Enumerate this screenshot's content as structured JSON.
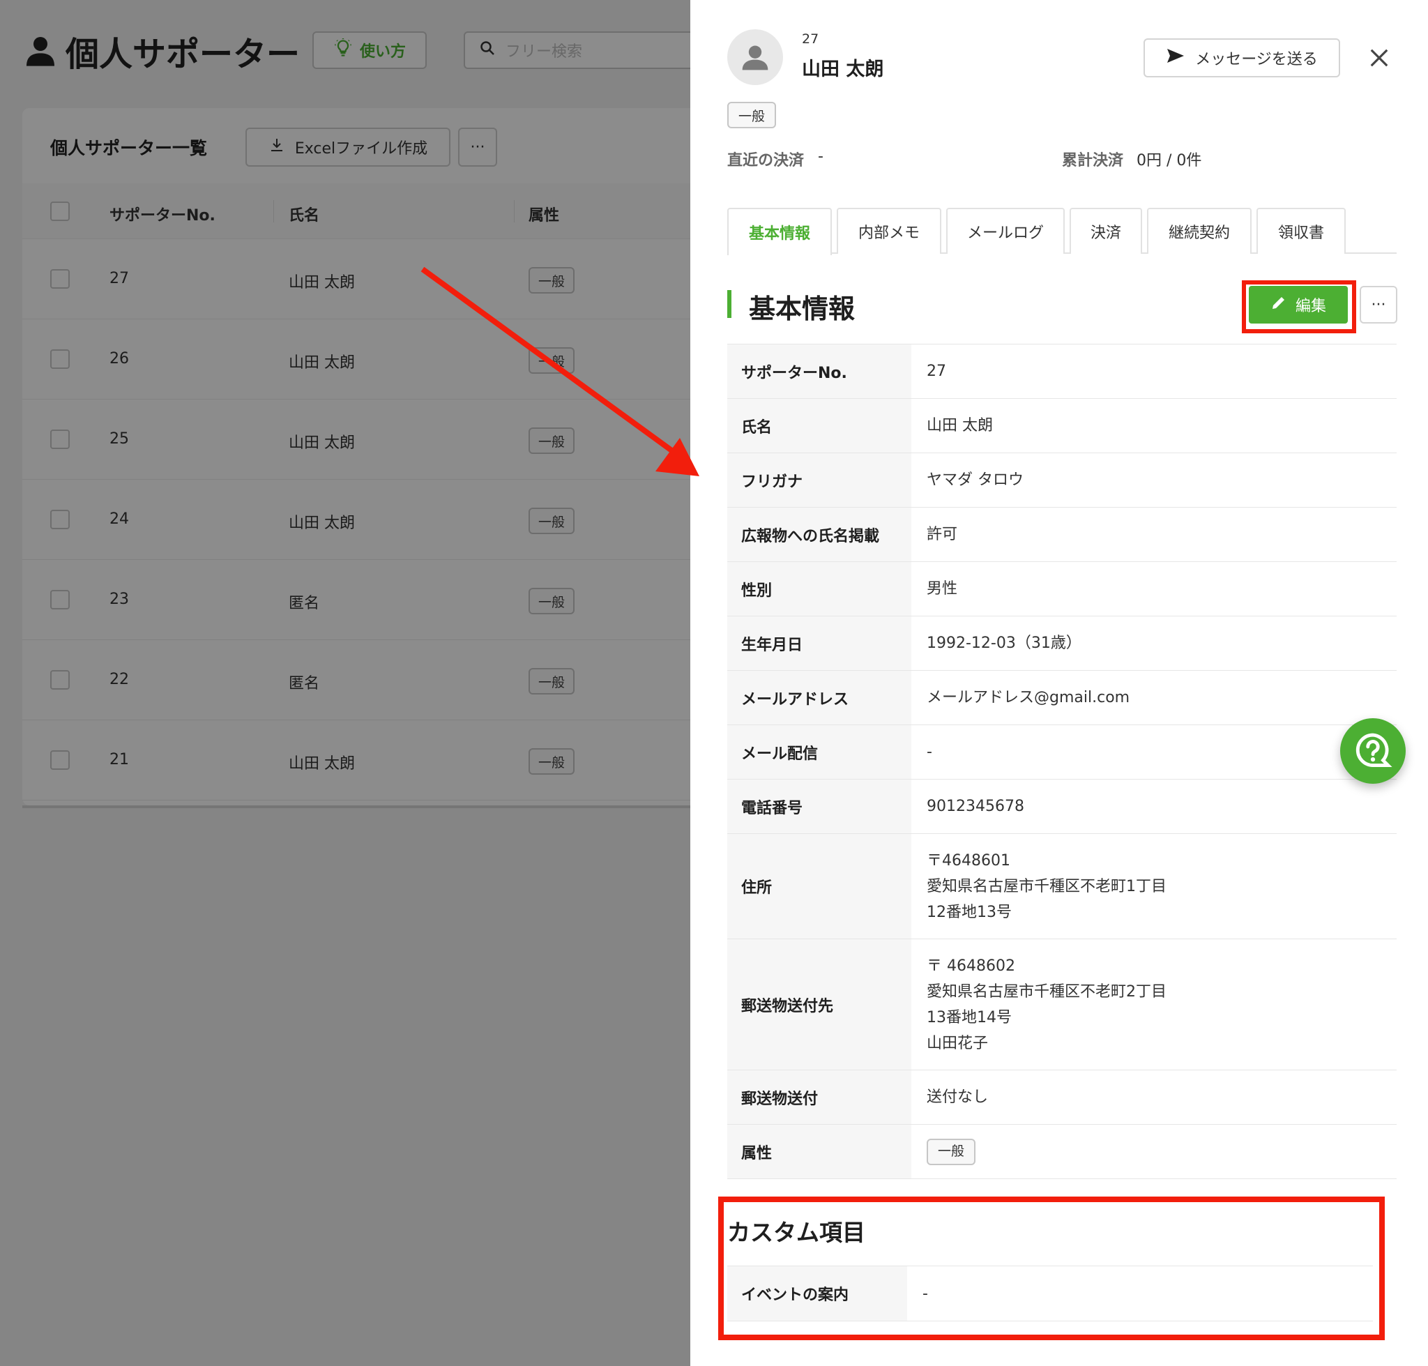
{
  "page": {
    "title": "個人サポーター",
    "howto_label": "使い方",
    "search_placeholder": "フリー検索"
  },
  "list": {
    "title": "個人サポーター一覧",
    "excel_button": "Excelファイル作成",
    "more_label": "···",
    "columns": [
      "サポーターNo.",
      "氏名",
      "属性"
    ],
    "rows": [
      {
        "no": "27",
        "name": "山田 太朗",
        "attr": "一般"
      },
      {
        "no": "26",
        "name": "山田 太朗",
        "attr": "一般"
      },
      {
        "no": "25",
        "name": "山田 太朗",
        "attr": "一般"
      },
      {
        "no": "24",
        "name": "山田 太朗",
        "attr": "一般"
      },
      {
        "no": "23",
        "name": "匿名",
        "attr": "一般"
      },
      {
        "no": "22",
        "name": "匿名",
        "attr": "一般"
      },
      {
        "no": "21",
        "name": "山田 太朗",
        "attr": "一般"
      }
    ]
  },
  "drawer": {
    "supporter_no": "27",
    "name": "山田 太朗",
    "message_button": "メッセージを送る",
    "attribute_tag": "一般",
    "recent_payment_label": "直近の決済",
    "recent_payment_value": "-",
    "total_payment_label": "累計決済",
    "total_payment_value": "0円 / 0件",
    "tabs": [
      "基本情報",
      "内部メモ",
      "メールログ",
      "決済",
      "継続契約",
      "領収書"
    ],
    "section_title": "基本情報",
    "edit_button": "編集",
    "more_label": "···",
    "fields": [
      {
        "label": "サポーターNo.",
        "value": [
          "27"
        ]
      },
      {
        "label": "氏名",
        "value": [
          "山田 太朗"
        ]
      },
      {
        "label": "フリガナ",
        "value": [
          "ヤマダ タロウ"
        ]
      },
      {
        "label": "広報物への氏名掲載",
        "value": [
          "許可"
        ]
      },
      {
        "label": "性別",
        "value": [
          "男性"
        ]
      },
      {
        "label": "生年月日",
        "value": [
          "1992-12-03（31歳）"
        ]
      },
      {
        "label": "メールアドレス",
        "value": [
          "メールアドレス@gmail.com"
        ]
      },
      {
        "label": "メール配信",
        "value": [
          "-"
        ]
      },
      {
        "label": "電話番号",
        "value": [
          "9012345678"
        ]
      },
      {
        "label": "住所",
        "value": [
          "〒4648601",
          "愛知県名古屋市千種区不老町1丁目",
          "12番地13号"
        ]
      },
      {
        "label": "郵送物送付先",
        "value": [
          "〒 4648602",
          "愛知県名古屋市千種区不老町2丁目",
          "13番地14号",
          "山田花子"
        ]
      },
      {
        "label": "郵送物送付",
        "value": [
          "送付なし"
        ]
      },
      {
        "label": "属性",
        "value": [],
        "tag": "一般"
      }
    ],
    "custom_title": "カスタム項目",
    "custom_fields": [
      {
        "label": "イベントの案内",
        "value": "-"
      }
    ]
  },
  "colors": {
    "accent": "#4caf33",
    "highlight": "#f21e0c"
  },
  "icons": [
    "person-icon",
    "lightbulb-icon",
    "search-icon",
    "download-icon",
    "send-icon",
    "close-icon",
    "pencil-icon",
    "help-icon",
    "arrow-annotation"
  ]
}
